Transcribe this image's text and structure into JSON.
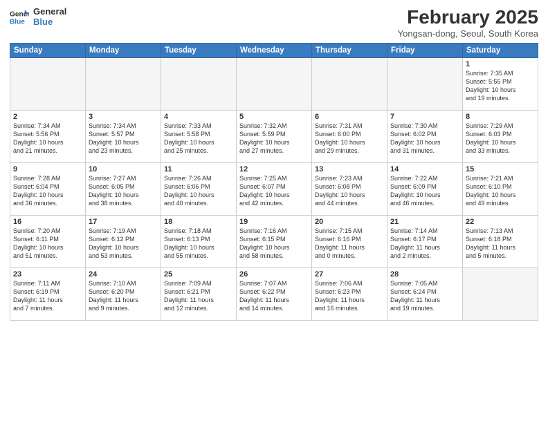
{
  "header": {
    "logo_line1": "General",
    "logo_line2": "Blue",
    "month": "February 2025",
    "location": "Yongsan-dong, Seoul, South Korea"
  },
  "weekdays": [
    "Sunday",
    "Monday",
    "Tuesday",
    "Wednesday",
    "Thursday",
    "Friday",
    "Saturday"
  ],
  "weeks": [
    [
      {
        "day": "",
        "info": ""
      },
      {
        "day": "",
        "info": ""
      },
      {
        "day": "",
        "info": ""
      },
      {
        "day": "",
        "info": ""
      },
      {
        "day": "",
        "info": ""
      },
      {
        "day": "",
        "info": ""
      },
      {
        "day": "1",
        "info": "Sunrise: 7:35 AM\nSunset: 5:55 PM\nDaylight: 10 hours\nand 19 minutes."
      }
    ],
    [
      {
        "day": "2",
        "info": "Sunrise: 7:34 AM\nSunset: 5:56 PM\nDaylight: 10 hours\nand 21 minutes."
      },
      {
        "day": "3",
        "info": "Sunrise: 7:34 AM\nSunset: 5:57 PM\nDaylight: 10 hours\nand 23 minutes."
      },
      {
        "day": "4",
        "info": "Sunrise: 7:33 AM\nSunset: 5:58 PM\nDaylight: 10 hours\nand 25 minutes."
      },
      {
        "day": "5",
        "info": "Sunrise: 7:32 AM\nSunset: 5:59 PM\nDaylight: 10 hours\nand 27 minutes."
      },
      {
        "day": "6",
        "info": "Sunrise: 7:31 AM\nSunset: 6:00 PM\nDaylight: 10 hours\nand 29 minutes."
      },
      {
        "day": "7",
        "info": "Sunrise: 7:30 AM\nSunset: 6:02 PM\nDaylight: 10 hours\nand 31 minutes."
      },
      {
        "day": "8",
        "info": "Sunrise: 7:29 AM\nSunset: 6:03 PM\nDaylight: 10 hours\nand 33 minutes."
      }
    ],
    [
      {
        "day": "9",
        "info": "Sunrise: 7:28 AM\nSunset: 6:04 PM\nDaylight: 10 hours\nand 36 minutes."
      },
      {
        "day": "10",
        "info": "Sunrise: 7:27 AM\nSunset: 6:05 PM\nDaylight: 10 hours\nand 38 minutes."
      },
      {
        "day": "11",
        "info": "Sunrise: 7:26 AM\nSunset: 6:06 PM\nDaylight: 10 hours\nand 40 minutes."
      },
      {
        "day": "12",
        "info": "Sunrise: 7:25 AM\nSunset: 6:07 PM\nDaylight: 10 hours\nand 42 minutes."
      },
      {
        "day": "13",
        "info": "Sunrise: 7:23 AM\nSunset: 6:08 PM\nDaylight: 10 hours\nand 44 minutes."
      },
      {
        "day": "14",
        "info": "Sunrise: 7:22 AM\nSunset: 6:09 PM\nDaylight: 10 hours\nand 46 minutes."
      },
      {
        "day": "15",
        "info": "Sunrise: 7:21 AM\nSunset: 6:10 PM\nDaylight: 10 hours\nand 49 minutes."
      }
    ],
    [
      {
        "day": "16",
        "info": "Sunrise: 7:20 AM\nSunset: 6:11 PM\nDaylight: 10 hours\nand 51 minutes."
      },
      {
        "day": "17",
        "info": "Sunrise: 7:19 AM\nSunset: 6:12 PM\nDaylight: 10 hours\nand 53 minutes."
      },
      {
        "day": "18",
        "info": "Sunrise: 7:18 AM\nSunset: 6:13 PM\nDaylight: 10 hours\nand 55 minutes."
      },
      {
        "day": "19",
        "info": "Sunrise: 7:16 AM\nSunset: 6:15 PM\nDaylight: 10 hours\nand 58 minutes."
      },
      {
        "day": "20",
        "info": "Sunrise: 7:15 AM\nSunset: 6:16 PM\nDaylight: 11 hours\nand 0 minutes."
      },
      {
        "day": "21",
        "info": "Sunrise: 7:14 AM\nSunset: 6:17 PM\nDaylight: 11 hours\nand 2 minutes."
      },
      {
        "day": "22",
        "info": "Sunrise: 7:13 AM\nSunset: 6:18 PM\nDaylight: 11 hours\nand 5 minutes."
      }
    ],
    [
      {
        "day": "23",
        "info": "Sunrise: 7:11 AM\nSunset: 6:19 PM\nDaylight: 11 hours\nand 7 minutes."
      },
      {
        "day": "24",
        "info": "Sunrise: 7:10 AM\nSunset: 6:20 PM\nDaylight: 11 hours\nand 9 minutes."
      },
      {
        "day": "25",
        "info": "Sunrise: 7:09 AM\nSunset: 6:21 PM\nDaylight: 11 hours\nand 12 minutes."
      },
      {
        "day": "26",
        "info": "Sunrise: 7:07 AM\nSunset: 6:22 PM\nDaylight: 11 hours\nand 14 minutes."
      },
      {
        "day": "27",
        "info": "Sunrise: 7:06 AM\nSunset: 6:23 PM\nDaylight: 11 hours\nand 16 minutes."
      },
      {
        "day": "28",
        "info": "Sunrise: 7:05 AM\nSunset: 6:24 PM\nDaylight: 11 hours\nand 19 minutes."
      },
      {
        "day": "",
        "info": ""
      }
    ]
  ]
}
